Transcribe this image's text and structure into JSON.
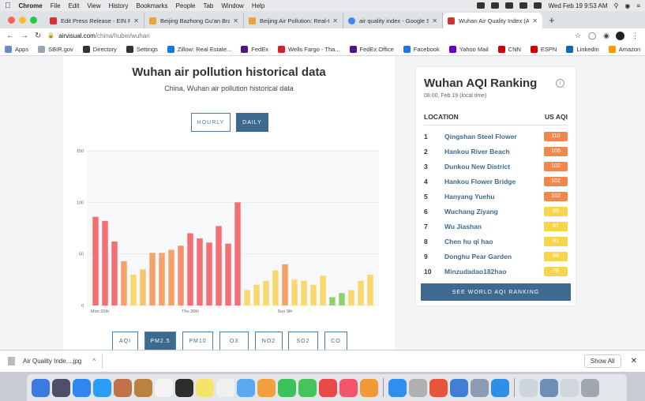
{
  "menubar": {
    "apple": "",
    "app": "Chrome",
    "items": [
      "File",
      "Edit",
      "View",
      "History",
      "Bookmarks",
      "People",
      "Tab",
      "Window",
      "Help"
    ],
    "clock": "Wed Feb 19  9:53 AM"
  },
  "tabs": [
    {
      "title": "Edit Press Release - EIN Presswire",
      "color": "#d0342c"
    },
    {
      "title": "Beijing Bazhong Gu'an Branch",
      "color": "#e8a33d"
    },
    {
      "title": "Beijing Air Pollution: Real-time",
      "color": "#e8a33d"
    },
    {
      "title": "air quality index - Google Search",
      "color": "#4285f4"
    },
    {
      "title": "Wuhan Air Quality Index (AQI)",
      "color": "#d0342c"
    }
  ],
  "toolbar": {
    "url_host": "airvisual.com",
    "url_path": "/china/hubei/wuhan"
  },
  "bookmarks": [
    {
      "label": "Apps",
      "color": "#6b8ac7"
    },
    {
      "label": "SBIR.gov",
      "color": "#9aa5b1"
    },
    {
      "label": "Directory",
      "color": "#333333"
    },
    {
      "label": "Settings",
      "color": "#333333"
    },
    {
      "label": "Zillow: Real Estate...",
      "color": "#1277e1"
    },
    {
      "label": "FedEx",
      "color": "#4d148c"
    },
    {
      "label": "Wells Fargo - Tha...",
      "color": "#d71e28"
    },
    {
      "label": "FedEx Office",
      "color": "#4d148c"
    },
    {
      "label": "Facebook",
      "color": "#1877f2"
    },
    {
      "label": "Yahoo Mail",
      "color": "#6001d2"
    },
    {
      "label": "CNN",
      "color": "#cc0000"
    },
    {
      "label": "ESPN",
      "color": "#d00000"
    },
    {
      "label": "LinkedIn",
      "color": "#0a66c2"
    },
    {
      "label": "Amazon",
      "color": "#ff9900"
    }
  ],
  "bookmarks_more": "»",
  "history": {
    "title": "Wuhan air pollution historical data",
    "subtitle": "China, Wuhan air pollution historical data",
    "hourly": "HOURLY",
    "daily": "DAILY"
  },
  "pollutant_buttons": [
    "AQI",
    "PM2.5",
    "PM10",
    "O3",
    "NO2",
    "SO2",
    "CO"
  ],
  "chart_data": {
    "type": "bar",
    "ylim": [
      0,
      150
    ],
    "yticks": [
      0,
      50,
      100,
      150
    ],
    "xtick_labels": [
      {
        "index": 0,
        "label": "Mon 20th"
      },
      {
        "index": 10,
        "label": "Thu 30th"
      },
      {
        "index": 20,
        "label": "Sun 9th"
      }
    ],
    "values": [
      86,
      82,
      62,
      43,
      30,
      35,
      51,
      51,
      54,
      58,
      70,
      65,
      61,
      77,
      60,
      100,
      15,
      20,
      24,
      34,
      40,
      25,
      24,
      20,
      29,
      8,
      12,
      15,
      24,
      30
    ],
    "colors": [
      "#f26f74",
      "#f26f74",
      "#f26f74",
      "#f5a26a",
      "#f9d86e",
      "#f9c46e",
      "#f5a26a",
      "#f5a26a",
      "#f5a26a",
      "#f5906a",
      "#f26f74",
      "#f26f74",
      "#f26f74",
      "#f26f74",
      "#f26f74",
      "#f26f74",
      "#f9d86e",
      "#f9d86e",
      "#f9d86e",
      "#f9d86e",
      "#f5a26a",
      "#f9d86e",
      "#f9d86e",
      "#f9d86e",
      "#f9d86e",
      "#8fd16e",
      "#8fd16e",
      "#f9d86e",
      "#f9d86e",
      "#f9d86e"
    ]
  },
  "ranking": {
    "title": "Wuhan AQI Ranking",
    "info": "i",
    "time": "08:00, Feb 19 (local time)",
    "col_location": "LOCATION",
    "col_aqi": "US AQI",
    "rows": [
      {
        "rank": "1",
        "name": "Qingshan Steel Flower",
        "aqi": "110",
        "color": "#f2874e"
      },
      {
        "rank": "2",
        "name": "Hankou River Beach",
        "aqi": "105",
        "color": "#f2874e"
      },
      {
        "rank": "3",
        "name": "Dunkou New District",
        "aqi": "102",
        "color": "#f2874e"
      },
      {
        "rank": "4",
        "name": "Hankou Flower Bridge",
        "aqi": "102",
        "color": "#f2874e"
      },
      {
        "rank": "5",
        "name": "Hanyang Yuehu",
        "aqi": "102",
        "color": "#f2874e"
      },
      {
        "rank": "6",
        "name": "Wuchang Ziyang",
        "aqi": "99",
        "color": "#f7d54a"
      },
      {
        "rank": "7",
        "name": "Wu Jiashan",
        "aqi": "97",
        "color": "#f7d54a"
      },
      {
        "rank": "8",
        "name": "Chen hu qi hao",
        "aqi": "91",
        "color": "#f7d54a"
      },
      {
        "rank": "9",
        "name": "Donghu Pear Garden",
        "aqi": "86",
        "color": "#f7d54a"
      },
      {
        "rank": "10",
        "name": "Minzudadao182hao",
        "aqi": "78",
        "color": "#f7d54a"
      }
    ],
    "cta": "SEE WORLD AQI RANKING"
  },
  "download": {
    "file": "Air Quality Inde....jpg",
    "chevron": "^",
    "show_all": "Show All",
    "close": "✕"
  },
  "dock_colors": [
    "#3b7be0",
    "#4f4f6a",
    "#2f86f0",
    "#2a9df4",
    "#c0724b",
    "#b88340",
    "#f4f4f4",
    "#2d2d2d",
    "#f5e36c",
    "#f0f0f0",
    "#5aa9ef",
    "#f2a03b",
    "#3cc25a",
    "#46c35a",
    "#e84a4a",
    "#f0556c",
    "#f29a38",
    "#2f8ff0",
    "#b0b0b0",
    "#e8553a",
    "#3f7fd6",
    "#8b9bb2",
    "#2d8fe8",
    "#cdd6df",
    "#6b8fb5",
    "#d0d6dd",
    "#a0a7b0"
  ]
}
